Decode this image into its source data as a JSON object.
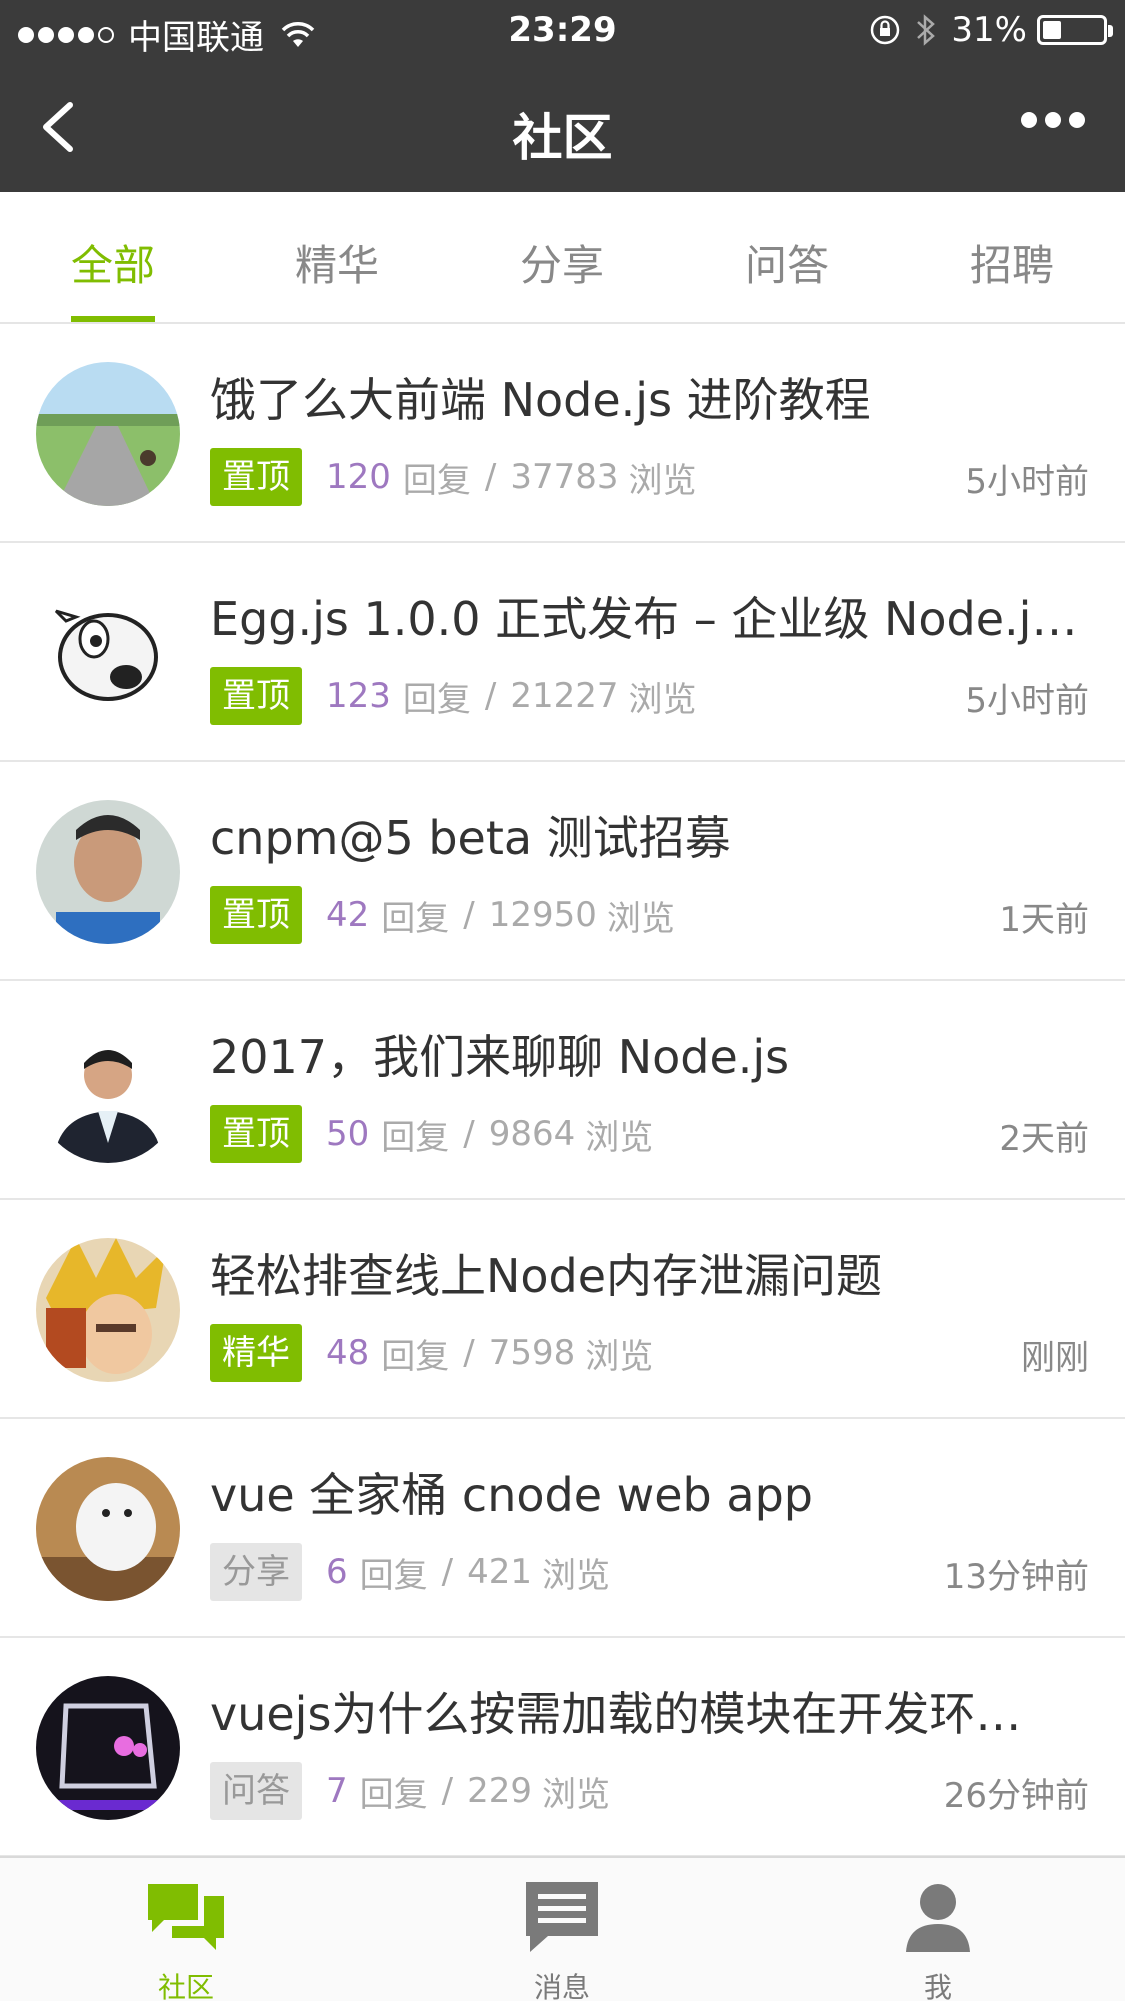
{
  "status_bar": {
    "carrier": "中国联通",
    "time": "23:29",
    "battery": "31%",
    "battery_level": 0.31
  },
  "nav": {
    "title": "社区"
  },
  "tabs": [
    {
      "label": "全部",
      "active": true
    },
    {
      "label": "精华",
      "active": false
    },
    {
      "label": "分享",
      "active": false
    },
    {
      "label": "问答",
      "active": false
    },
    {
      "label": "招聘",
      "active": false
    }
  ],
  "topics": [
    {
      "title": "饿了么大前端 Node.js 进阶教程",
      "badge": "置顶",
      "replies": "120",
      "reply_label": "回复",
      "views": "37783",
      "view_label": "浏览",
      "time": "5小时前"
    },
    {
      "title": "Egg.js 1.0.0 正式发布 – 企业级 Node.js…",
      "badge": "置顶",
      "replies": "123",
      "reply_label": "回复",
      "views": "21227",
      "view_label": "浏览",
      "time": "5小时前"
    },
    {
      "title": "cnpm@5 beta 测试招募",
      "badge": "置顶",
      "replies": "42",
      "reply_label": "回复",
      "views": "12950",
      "view_label": "浏览",
      "time": "1天前"
    },
    {
      "title": "2017，我们来聊聊 Node.js",
      "badge": "置顶",
      "replies": "50",
      "reply_label": "回复",
      "views": "9864",
      "view_label": "浏览",
      "time": "2天前"
    },
    {
      "title": "轻松排查线上Node内存泄漏问题",
      "badge": "精华",
      "replies": "48",
      "reply_label": "回复",
      "views": "7598",
      "view_label": "浏览",
      "time": "刚刚"
    },
    {
      "title": "vue 全家桶 cnode web app",
      "badge": "分享",
      "replies": "6",
      "reply_label": "回复",
      "views": "421",
      "view_label": "浏览",
      "time": "13分钟前"
    },
    {
      "title": "vuejs为什么按需加载的模块在开发环…",
      "badge": "问答",
      "replies": "7",
      "reply_label": "回复",
      "views": "229",
      "view_label": "浏览",
      "time": "26分钟前"
    }
  ],
  "tabbar": [
    {
      "label": "社区",
      "icon": "community-icon",
      "active": true
    },
    {
      "label": "消息",
      "icon": "message-icon",
      "active": false
    },
    {
      "label": "我",
      "icon": "person-icon",
      "active": false
    }
  ],
  "colors": {
    "accent": "#80bd01",
    "reply_count": "#9e78c0",
    "header_bg": "#3b3b3b"
  }
}
